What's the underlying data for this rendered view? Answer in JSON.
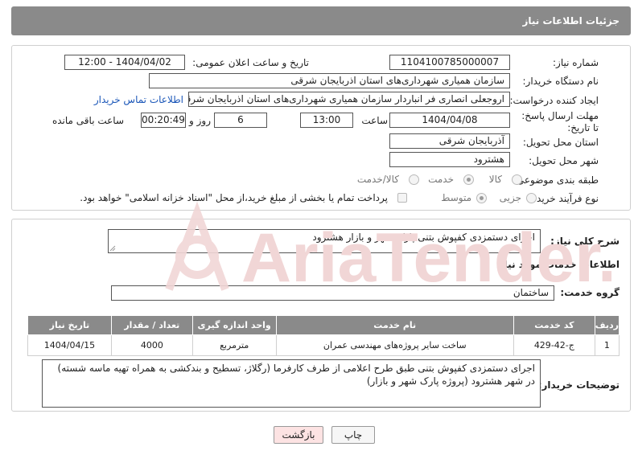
{
  "header": {
    "title": "جزئیات اطلاعات نیاز"
  },
  "form": {
    "need_number_label": "شماره نیاز:",
    "need_number": "1104100785000007",
    "announce_label": "تاریخ و ساعت اعلان عمومی:",
    "announce_value": "1404/04/02 - 12:00",
    "buyer_org_label": "نام دستگاه خریدار:",
    "buyer_org": "سازمان همیاری شهرداری‌های استان اذربایجان شرقی",
    "requester_label": "ایجاد کننده درخواست:",
    "requester": "اروجعلی انصاری فر انباردار سازمان همیاری شهرداری‌های استان اذربایجان شرقی",
    "contact_link": "اطلاعات تماس خریدار",
    "deadline_label": "مهلت ارسال پاسخ: تا تاریخ:",
    "deadline_date": "1404/04/08",
    "time_label": "ساعت",
    "deadline_time": "13:00",
    "days_value": "6",
    "days_label": "روز و",
    "remaining_value": "00:20:49",
    "remaining_label": "ساعت باقی مانده",
    "province_label": "استان محل تحویل:",
    "province": "آذربایجان شرقی",
    "city_label": "شهر محل تحویل:",
    "city": "هشترود",
    "category_label": "طبقه بندی موضوعی:",
    "category_options": [
      "کالا",
      "خدمت",
      "کالا/خدمت"
    ],
    "category_selected": "خدمت",
    "process_label": "نوع فرآیند خرید :",
    "process_options": [
      "جزیی",
      "متوسط"
    ],
    "process_selected": "جزیی",
    "payment_note": "پرداخت تمام یا بخشی از مبلغ خرید،از محل \"اسناد خزانه اسلامی\" خواهد بود."
  },
  "summary": {
    "label": "شرح کلی نیاز:",
    "value": "اجرای دستمزدی کفپوش بتنی پارک شهر و بازار هشترود"
  },
  "services": {
    "section_title": "اطلاعات خدمات مورد نیاز",
    "group_label": "گروه خدمت:",
    "group_value": "ساختمان",
    "columns": [
      "ردیف",
      "کد خدمت",
      "نام خدمت",
      "واحد اندازه گیری",
      "تعداد / مقدار",
      "تاریخ نیاز"
    ],
    "rows": [
      [
        "1",
        "ج-42-429",
        "ساخت سایر پروژه‌های مهندسی عمران",
        "مترمربع",
        "4000",
        "1404/04/15"
      ]
    ]
  },
  "buyer_notes": {
    "label": "توضیحات خریدار:",
    "value": "اجرای دستمزدی کفپوش بتنی طبق طرح اعلامی از طرف کارفرما (رگلاژ، تسطیح و بندکشی به همراه تهیه ماسه شسته) در شهر هشترود (پروژه پارک شهر و بازار)"
  },
  "buttons": {
    "print": "چاپ",
    "back": "بازگشت"
  },
  "watermark": {
    "text": "AriaTender.neT"
  },
  "colors": {
    "header_bg": "#8a8a8a",
    "link": "#1a56b8",
    "back_btn_bg": "#fde3e3",
    "watermark": "#f1d6d6"
  }
}
